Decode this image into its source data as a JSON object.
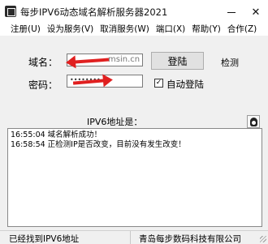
{
  "window": {
    "title": "每步IPV6动态域名解析服务器2021",
    "minimize_label": "",
    "close_label": "✕"
  },
  "menu": [
    {
      "label": "注册(U)"
    },
    {
      "label": "设为服务(V)"
    },
    {
      "label": "取消服务(W)"
    },
    {
      "label": "端口(X)"
    },
    {
      "label": "帮助(Y)"
    },
    {
      "label": "合作(Z)"
    }
  ],
  "form": {
    "domain_label": "域名：",
    "domain_value": "msin.cn",
    "password_label": "密码：",
    "password_value": "••••••••",
    "login_button": "登陆",
    "detect_label": "检测",
    "auto_login_label": "自动登陆",
    "auto_login_checked": true,
    "ipv6_label": "IPV6地址是：",
    "ipv6_value": ""
  },
  "log": {
    "lines": [
      "16:55:04 域名解析成功！",
      "16:58:54 正检测IP是否改变，目前没有发生改变！"
    ]
  },
  "status": {
    "left": "已经找到IPV6地址",
    "right": "青岛每步数码科技有限公司"
  },
  "colors": {
    "arrow": "#e02020"
  }
}
